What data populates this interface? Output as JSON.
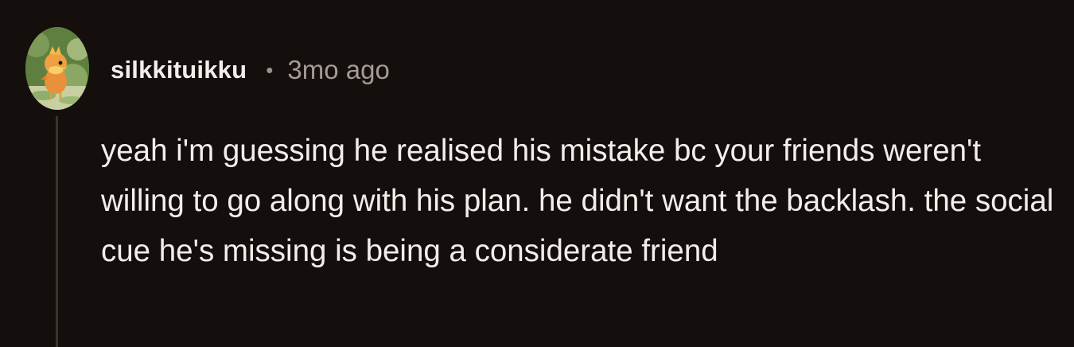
{
  "comment": {
    "username": "silkkituikku",
    "separator": "•",
    "timestamp": "3mo ago",
    "avatar_icon": "torchic-avatar-icon",
    "body": "yeah i'm guessing he realised his mistake bc your friends weren't willing to go along with his plan. he didn't want the backlash. the social cue he's missing is being a considerate friend"
  },
  "colors": {
    "background": "#140f0d",
    "text": "#f2eeeb",
    "muted": "#a49b96",
    "thread_line": "#3a3431"
  }
}
